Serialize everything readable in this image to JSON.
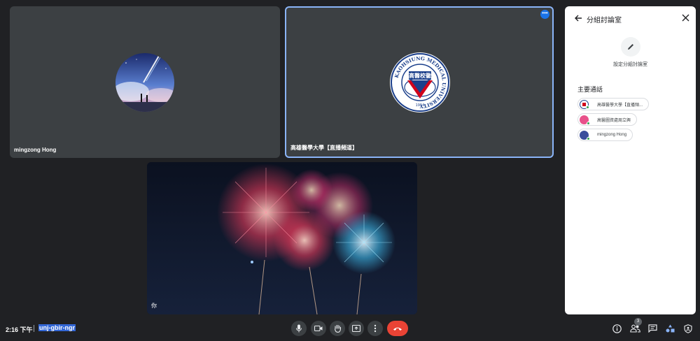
{
  "tiles": [
    {
      "name": "mingzong Hong"
    },
    {
      "name": "高雄醫學大學【直播頻道】"
    },
    {
      "name": "你"
    }
  ],
  "logo": {
    "ring_text": "KAOHSIUNG MEDICAL UNIVERSITY",
    "center_text": "高醫校徽",
    "year": "1954"
  },
  "panel": {
    "title": "分組討論室",
    "setup_label": "設定分組討論室",
    "main_call_title": "主要通話",
    "participants": [
      {
        "name": "高雄醫學大學【直播頻..."
      },
      {
        "name": "高醫圖資處周立興"
      },
      {
        "name": "mingzong Hong"
      }
    ]
  },
  "bottom": {
    "time": "2:16 下午",
    "meeting_code": "unj-gbir-ngr",
    "people_count": "3"
  },
  "colors": {
    "background": "#202124",
    "tile": "#3c4043",
    "active_border": "#8ab4f8",
    "end_call": "#ea4335",
    "online": "#34a853"
  },
  "icons": {
    "mic": "mic-icon",
    "camera": "camera-icon",
    "hand": "raise-hand-icon",
    "present": "present-icon",
    "more": "more-vert-icon",
    "end_call": "end-call-icon",
    "info": "info-icon",
    "people": "people-icon",
    "chat": "chat-icon",
    "activities": "activities-icon",
    "host": "host-controls-icon"
  }
}
